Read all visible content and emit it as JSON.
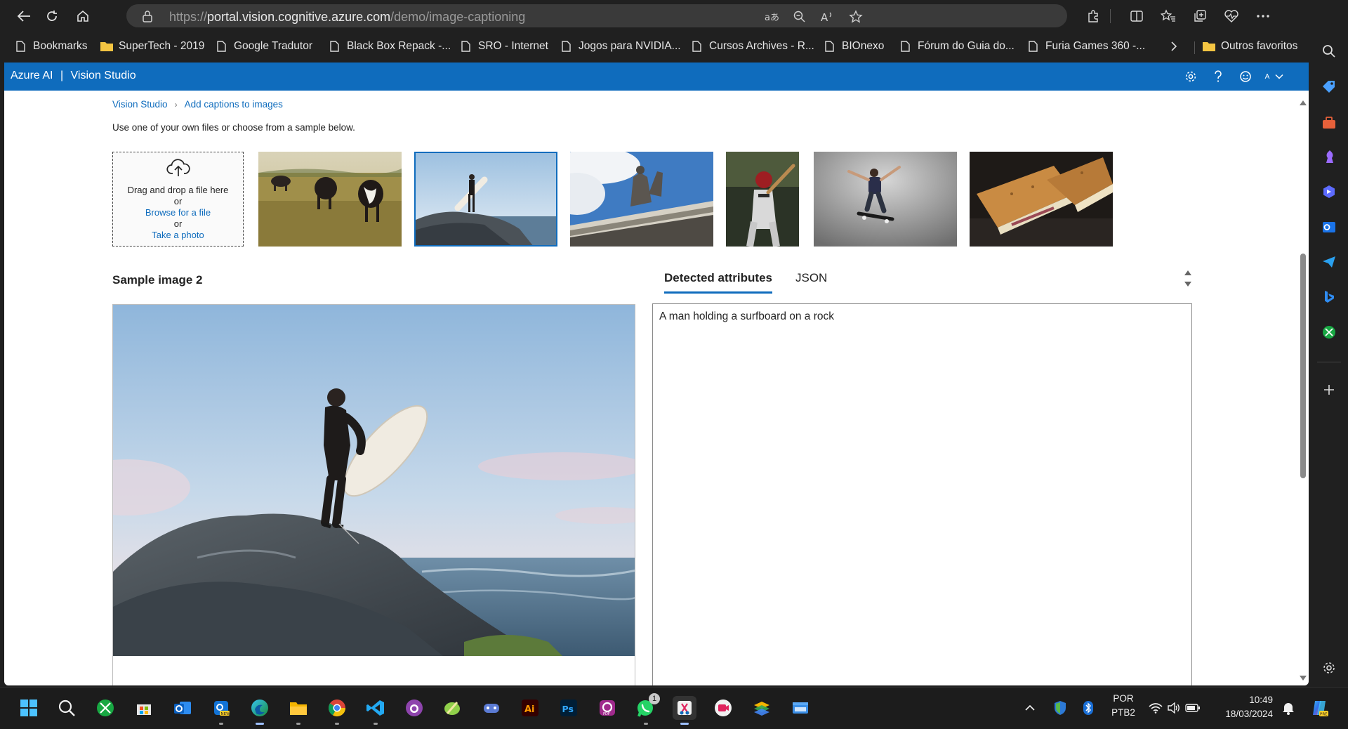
{
  "browser": {
    "url_prefix": "https://",
    "url_host": "portal.vision.cognitive.azure.com",
    "url_path": "/demo/image-captioning"
  },
  "bookmarks": [
    {
      "label": "Bookmarks",
      "icon": "bookmark-page-icon"
    },
    {
      "label": "SuperTech - 2019",
      "icon": "folder-icon"
    },
    {
      "label": "Google Tradutor",
      "icon": "page-icon"
    },
    {
      "label": "Black Box Repack -...",
      "icon": "page-icon"
    },
    {
      "label": "SRO - Internet",
      "icon": "page-icon"
    },
    {
      "label": "Jogos para NVIDIA...",
      "icon": "page-icon"
    },
    {
      "label": "Cursos Archives - R...",
      "icon": "page-icon"
    },
    {
      "label": "BIOnexo",
      "icon": "page-icon"
    },
    {
      "label": "Fórum do Guia do...",
      "icon": "page-icon"
    },
    {
      "label": "Furia Games 360 -...",
      "icon": "page-icon"
    }
  ],
  "bookmarks_other": "Outros favoritos",
  "app": {
    "brand_left": "Azure AI",
    "brand_sep": "|",
    "brand_right": "Vision Studio",
    "account_initial": "A",
    "accent": "#0f6cbd"
  },
  "breadcrumb": {
    "root": "Vision Studio",
    "current": "Add captions to images"
  },
  "intro": "Use one of your own files or choose from a sample below.",
  "dropzone": {
    "line1": "Drag and drop a file here",
    "or1": "or",
    "browse": "Browse for a file",
    "or2": "or",
    "photo": "Take a photo"
  },
  "samples": [
    {
      "name": "cows-in-field"
    },
    {
      "name": "surfer-on-rock",
      "selected": true
    },
    {
      "name": "building-statues"
    },
    {
      "name": "baseball-batter"
    },
    {
      "name": "skateboarder"
    },
    {
      "name": "grilled-sandwich"
    }
  ],
  "main": {
    "sample_title": "Sample image 2",
    "tabs": [
      "Detected attributes",
      "JSON"
    ],
    "active_tab": "Detected attributes",
    "caption": "A man holding a surfboard on a rock"
  },
  "tray": {
    "lang": "POR",
    "layout": "PTB2",
    "time": "10:49",
    "date": "18/03/2024",
    "whatsapp_badge": "1"
  }
}
